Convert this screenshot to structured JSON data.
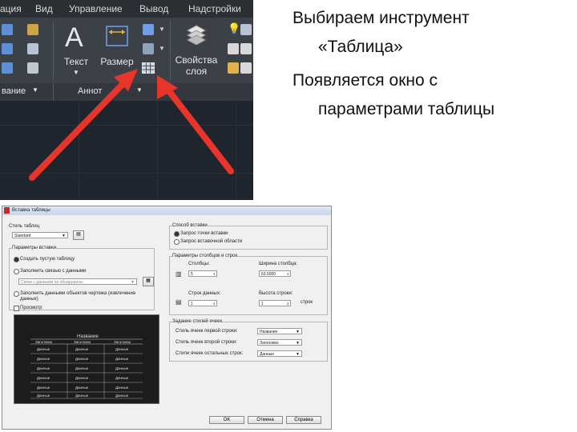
{
  "ribbon": {
    "menu_items": [
      {
        "label": "ация"
      },
      {
        "label": "Вид"
      },
      {
        "label": "Управление"
      },
      {
        "label": "Вывод"
      },
      {
        "label": "Надстройки"
      }
    ],
    "buttons": {
      "text_label": "Текст",
      "dimension_label": "Размер",
      "layer_props_line1": "Свойства",
      "layer_props_line2": "слоя"
    },
    "panel_titles": {
      "edit": "вание",
      "annotation": "Аннот"
    }
  },
  "slide_text": {
    "line1": "Выбираем инструмент",
    "line2": "«Таблица»",
    "line3": "Появляется окно с",
    "line4": "параметрами таблицы"
  },
  "dialog": {
    "title": "Вставка таблицы",
    "table_style_label": "Стиль таблиц",
    "table_style_value": "Standard",
    "insert_options_label": "Параметры вставки",
    "opt_empty": "Создать пустую таблицу",
    "opt_link": "Заполнить связью с данными",
    "link_placeholder": "Связи с данными не обнаружены",
    "opt_extract": "Заполнить данными объектов чертежа (извлечение данных)",
    "preview_check": "Просмотр",
    "insert_method_label": "Способ вставки",
    "point_radio": "Запрос точки вставки",
    "window_radio": "Запрос вставочной области",
    "colrow_label": "Параметры столбцов и строк",
    "columns_label": "Столбцы:",
    "columns_value": "5",
    "col_width_label": "Ширина столбца:",
    "col_width_value": "63.5000",
    "data_rows_label": "Строк данных:",
    "data_rows_value": "1",
    "row_height_label": "Высота строки:",
    "row_height_value": "1",
    "row_unit": "строк",
    "cellstyle_label": "Задание стилей ячеек",
    "first_row_label": "Стиль ячеек первой строки:",
    "first_row_value": "Название",
    "second_row_label": "Стиль ячеек второй строки:",
    "second_row_value": "Заголовок",
    "other_rows_label": "Стили ячеек остальных строк:",
    "other_rows_value": "Данные",
    "ok_label": "OK",
    "cancel_label": "Отмена",
    "help_label": "Справка",
    "preview": {
      "title": "Название",
      "headers": [
        "Заголовок",
        "Заголовок",
        "Заголовок"
      ],
      "cell": "Данные"
    }
  },
  "colors": {
    "arrow": "#e8352b",
    "ribbon_bg": "#3c4047"
  }
}
